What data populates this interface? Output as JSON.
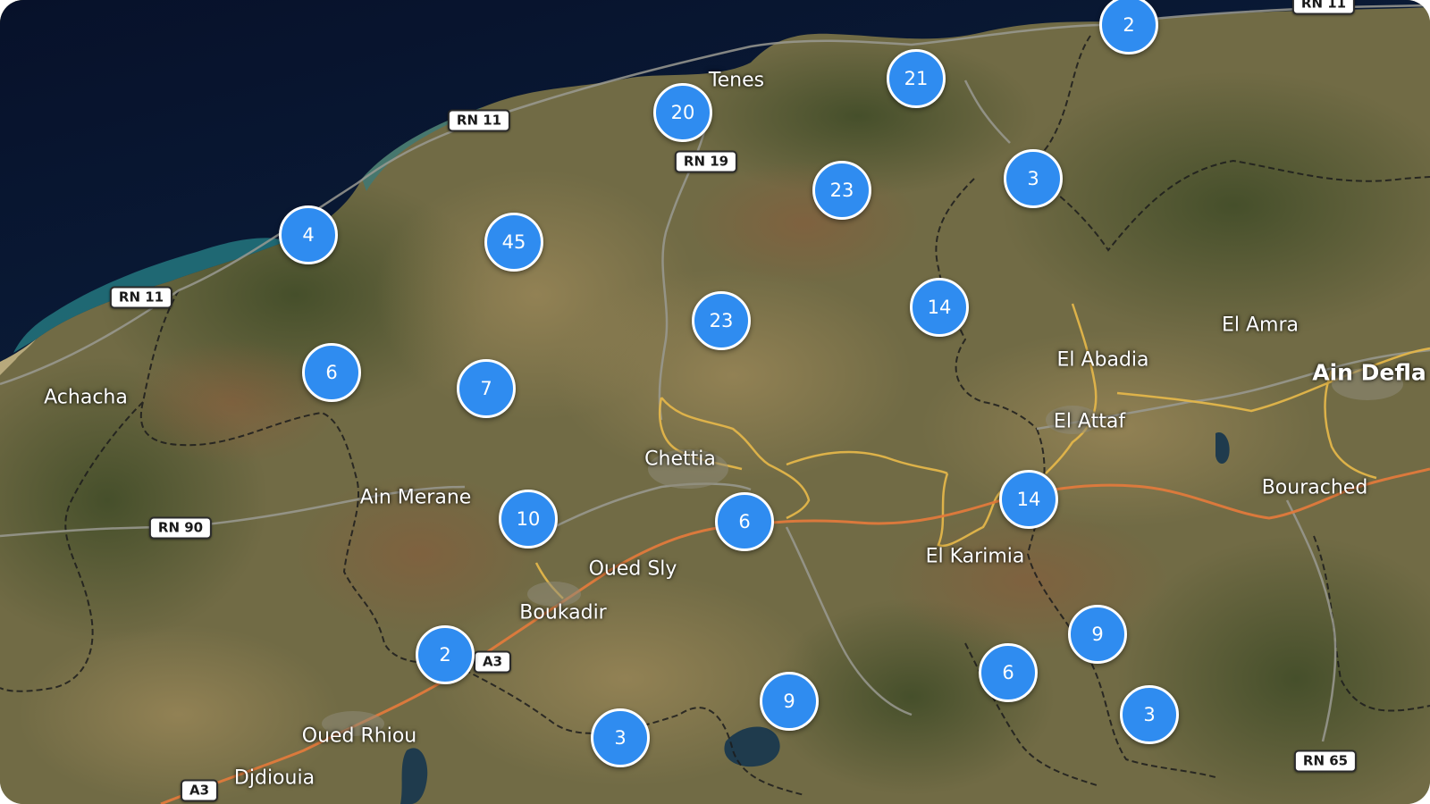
{
  "map": {
    "clusters": [
      {
        "count": "2"
      },
      {
        "count": "21"
      },
      {
        "count": "20"
      },
      {
        "count": "23"
      },
      {
        "count": "3"
      },
      {
        "count": "4"
      },
      {
        "count": "45"
      },
      {
        "count": "23"
      },
      {
        "count": "14"
      },
      {
        "count": "6"
      },
      {
        "count": "7"
      },
      {
        "count": "10"
      },
      {
        "count": "6"
      },
      {
        "count": "14"
      },
      {
        "count": "2"
      },
      {
        "count": "9"
      },
      {
        "count": "6"
      },
      {
        "count": "9"
      },
      {
        "count": "3"
      },
      {
        "count": "3"
      }
    ],
    "places": [
      {
        "name": "Tenes"
      },
      {
        "name": "Achacha"
      },
      {
        "name": "El Amra"
      },
      {
        "name": "El Abadia"
      },
      {
        "name": "Ain Defla"
      },
      {
        "name": "El Attaf"
      },
      {
        "name": "Chettia"
      },
      {
        "name": "Ain Merane"
      },
      {
        "name": "Bourached"
      },
      {
        "name": "Oued Sly"
      },
      {
        "name": "El Karimia"
      },
      {
        "name": "Boukadir"
      },
      {
        "name": "Oued Rhiou"
      },
      {
        "name": "Djdiouia"
      }
    ],
    "road_shields": [
      {
        "label": "RN 11"
      },
      {
        "label": "RN 11"
      },
      {
        "label": "RN 19"
      },
      {
        "label": "RN 11"
      },
      {
        "label": "RN 90"
      },
      {
        "label": "A3"
      },
      {
        "label": "A3"
      },
      {
        "label": "RN 65"
      }
    ],
    "colors": {
      "cluster": "#2f8cf0",
      "sea": "#0a1830",
      "land": "#6f6a44",
      "motorway": "#e07a3c",
      "main_road": "#e3b64a",
      "border": "#1c1c1c"
    }
  }
}
